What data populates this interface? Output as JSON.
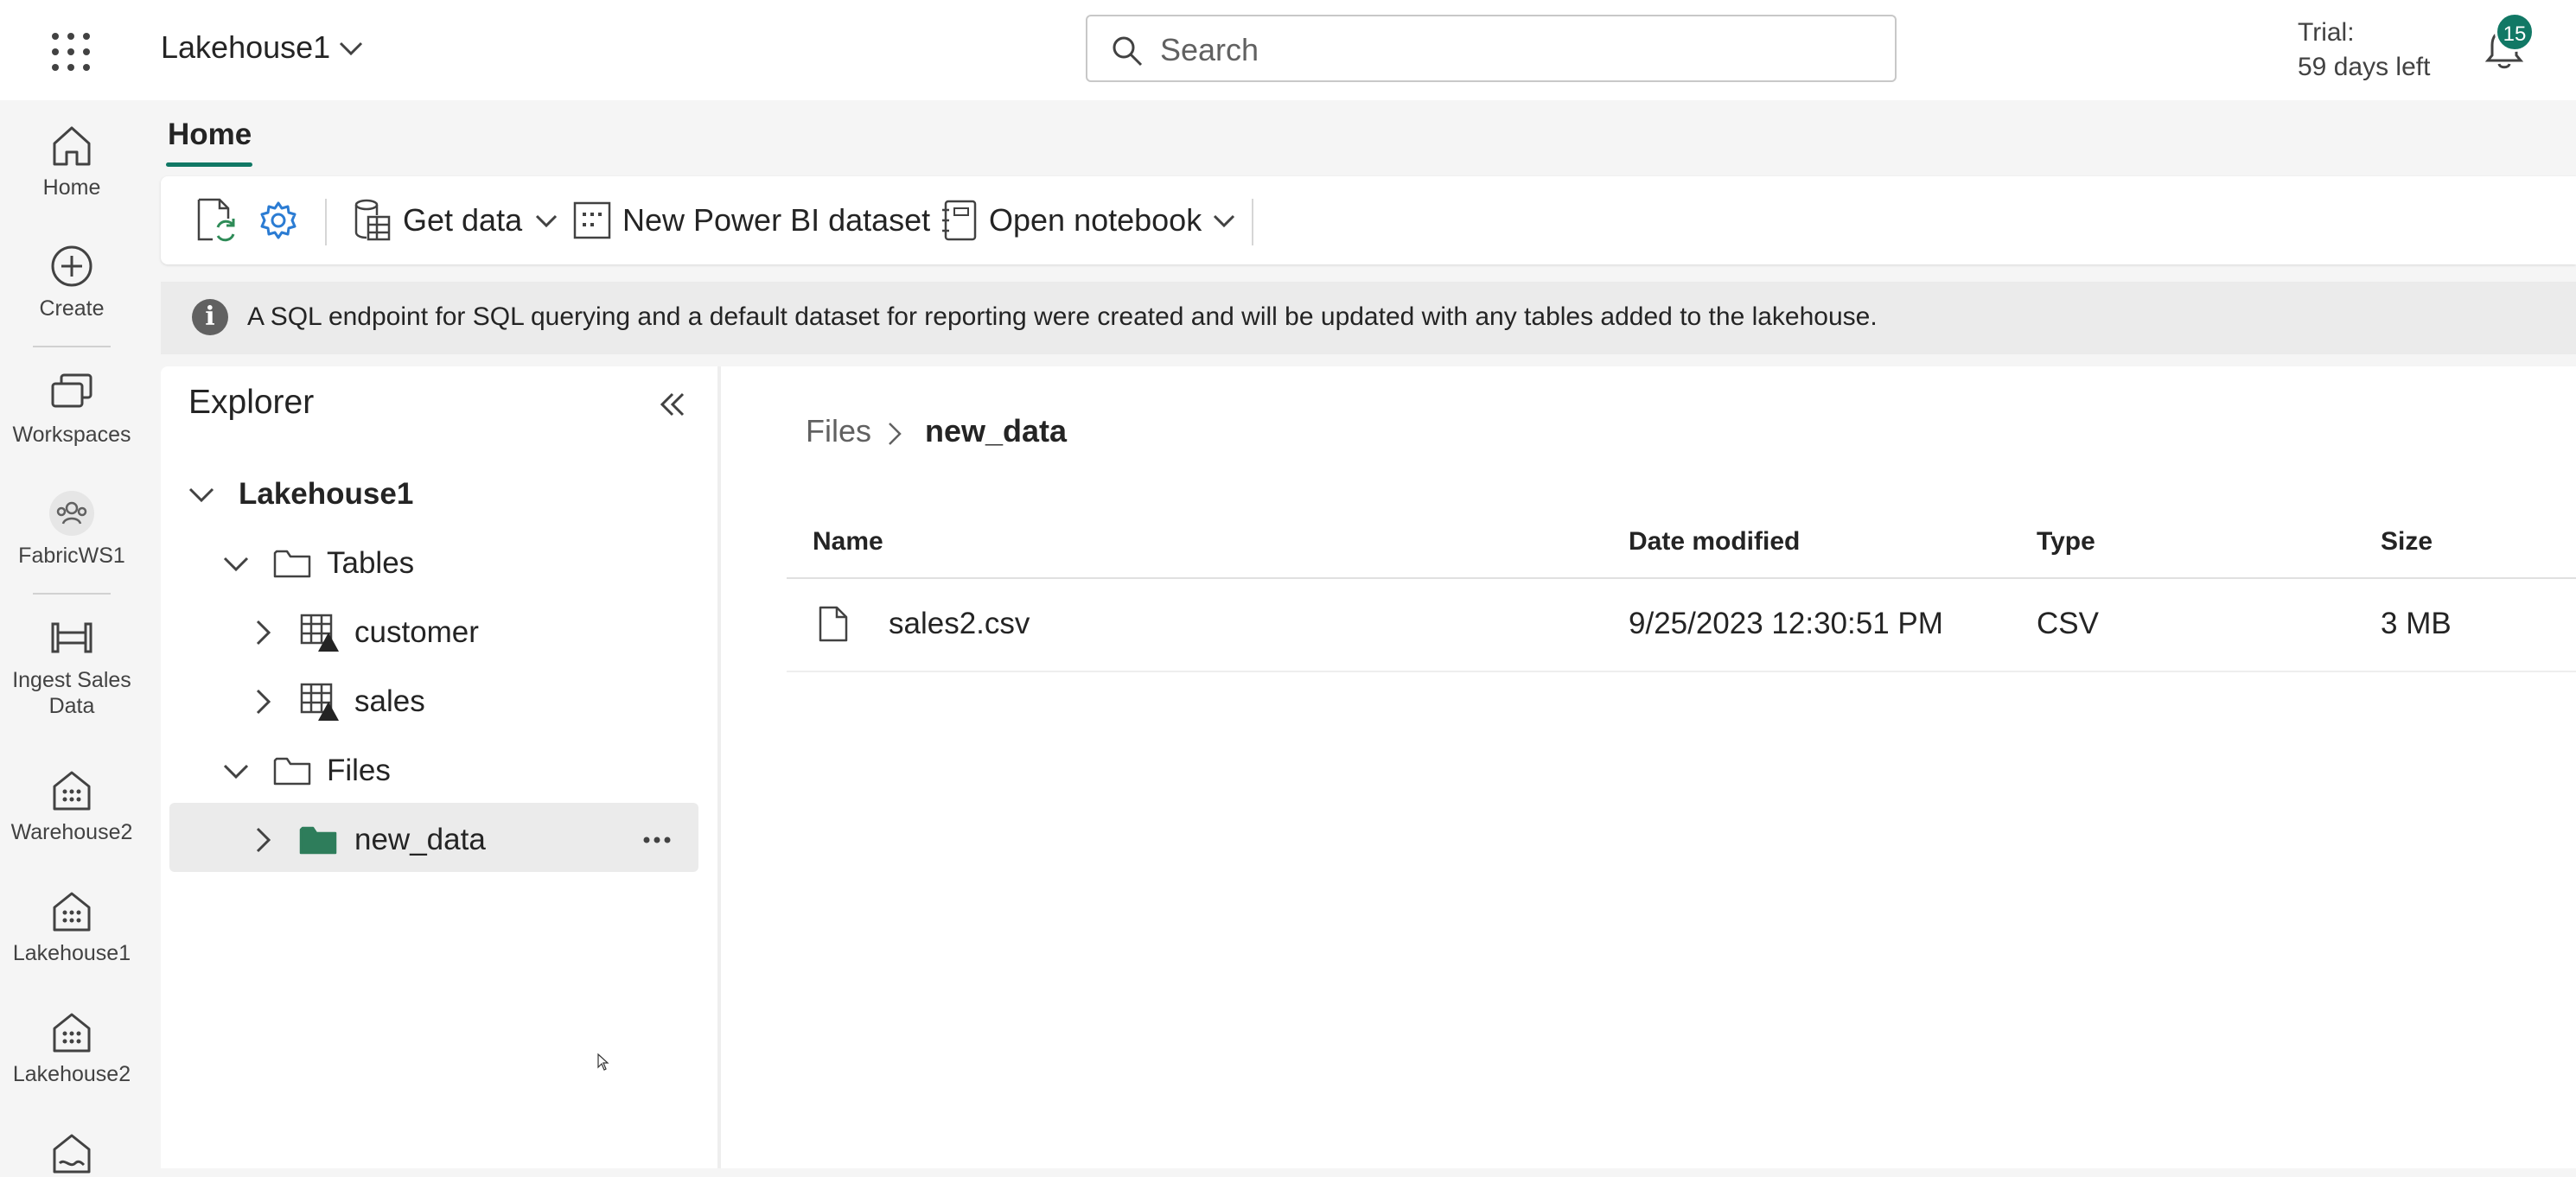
{
  "header": {
    "app_title": "Lakehouse1",
    "search_placeholder": "Search",
    "trial_line1": "Trial:",
    "trial_line2": "59 days left",
    "notification_count": "15"
  },
  "rail": {
    "items": [
      {
        "label": "Home",
        "icon": "home-icon"
      },
      {
        "label": "Create",
        "icon": "plus-circle-icon"
      },
      {
        "label": "Workspaces",
        "icon": "workspaces-icon"
      },
      {
        "label": "FabricWS1",
        "icon": "group-icon"
      },
      {
        "label": "Ingest Sales Data",
        "icon": "pipeline-icon"
      },
      {
        "label": "Warehouse2",
        "icon": "warehouse-icon"
      },
      {
        "label": "Lakehouse1",
        "icon": "lakehouse-icon"
      },
      {
        "label": "Lakehouse2",
        "icon": "lakehouse-icon"
      }
    ]
  },
  "tabs": {
    "home": "Home"
  },
  "toolbar": {
    "get_data": "Get data",
    "new_dataset": "New Power BI dataset",
    "open_notebook": "Open notebook"
  },
  "info": {
    "text": "A SQL endpoint for SQL querying and a default dataset for reporting were created and will be updated with any tables added to the lakehouse."
  },
  "explorer": {
    "title": "Explorer",
    "root": "Lakehouse1",
    "tables_label": "Tables",
    "tables": [
      "customer",
      "sales"
    ],
    "files_label": "Files",
    "folders": [
      "new_data"
    ]
  },
  "breadcrumb": {
    "root": "Files",
    "current": "new_data"
  },
  "file_table": {
    "columns": [
      "Name",
      "Date modified",
      "Type",
      "Size"
    ],
    "rows": [
      {
        "name": "sales2.csv",
        "modified": "9/25/2023 12:30:51 PM",
        "type": "CSV",
        "size": "3 MB"
      }
    ]
  },
  "colors": {
    "accent": "#117865",
    "info_bar": "#ebebeb"
  }
}
